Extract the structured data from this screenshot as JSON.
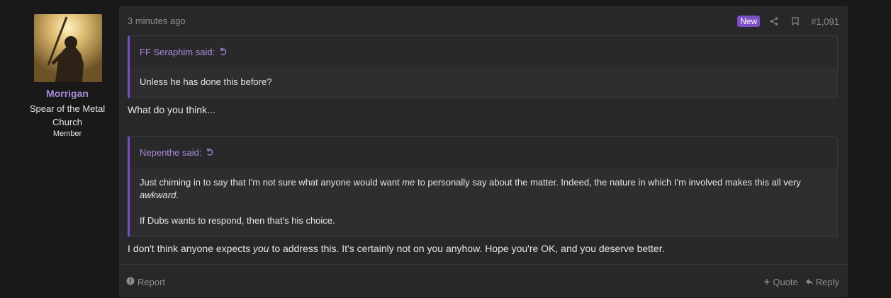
{
  "user": {
    "name": "Morrigan",
    "title": "Spear of the Metal Church",
    "role": "Member"
  },
  "post": {
    "time": "3 minutes ago",
    "badge": "New",
    "number": "#1,091",
    "quote1": {
      "author": "FF Seraphim said:",
      "text": "Unless he has done this before?"
    },
    "reply1": "What do you think...",
    "quote2": {
      "author": "Nepenthe said:",
      "line1_a": "Just chiming in to say that I'm not sure what anyone would want ",
      "line1_em": "me",
      "line1_b": " to personally say about the matter. Indeed, the nature in which I'm involved makes this all very ",
      "line1_em2": "awkward",
      "line1_c": ".",
      "line2": "If Dubs wants to respond, then that's his choice."
    },
    "reply2_a": "I don't think anyone expects ",
    "reply2_em": "you",
    "reply2_b": " to address this. It's certainly not on you anyhow. Hope you're OK, and you deserve better."
  },
  "footer": {
    "report": "Report",
    "quote": "Quote",
    "reply": "Reply"
  },
  "icons": {
    "share": "share-icon",
    "bookmark": "bookmark-icon",
    "revert": "arrow-up-icon",
    "report": "alert-circle-icon",
    "quote": "plus-icon",
    "reply": "reply-icon"
  },
  "colors": {
    "accent": "#7a4fc6",
    "username": "#a98bd9",
    "background": "#19191a",
    "panel": "#28282a"
  }
}
